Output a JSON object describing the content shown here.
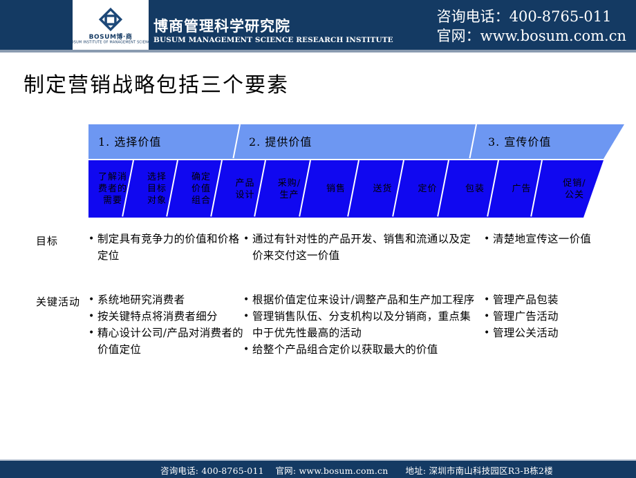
{
  "header": {
    "brand_cn": "博商管理科学研究院",
    "brand_en": "BUSUM MANAGEMENT SCIENCE RESEARCH INSTITUTE",
    "logo_word": "BOSUM博·商",
    "logo_sub": "BOSUM INSTITUTE OF MANAGEMENT SCIENCE",
    "phone_line": "咨询电话：400-8765-011",
    "web_line": "官网：www.bosum.com.cn"
  },
  "title": "制定营销战略包括三个要素",
  "banner": {
    "phases": [
      {
        "label": "1. 选择价值"
      },
      {
        "label": "2. 提供价值"
      },
      {
        "label": "3. 宣传价值"
      }
    ],
    "segments": [
      "了解消\n费者的\n需要",
      "选择\n目标\n对象",
      "确定\n价值\n组合",
      "产品\n设计",
      "采购/\n生产",
      "销售",
      "送货",
      "定价",
      "包装",
      "广告",
      "促销/\n公关"
    ],
    "colors": {
      "top_band": "#6d97f2",
      "bottom_band": "#1008f0",
      "divider": "#ffffff"
    }
  },
  "rows": [
    {
      "label": "目标",
      "columns": [
        {
          "items": [
            "制定具有竞争力的价值和价格定位"
          ]
        },
        {
          "items": [
            "通过有针对性的产品开发、销售和流通以及定价来交付这一价值"
          ]
        },
        {
          "items": [
            "清楚地宣传这一价值"
          ]
        }
      ]
    },
    {
      "label": "关键活动",
      "columns": [
        {
          "items": [
            "系统地研究消费者",
            "按关键特点将消费者细分",
            "精心设计公司/产品对消费者的价值定位"
          ]
        },
        {
          "items": [
            "根据价值定位来设计/调整产品和生产加工程序",
            "管理销售队伍、分支机构以及分销商，重点集中于优先性最高的活动",
            "给整个产品组合定价以获取最大的价值"
          ]
        },
        {
          "items": [
            "管理产品包装",
            "管理广告活动",
            "管理公关活动"
          ]
        }
      ]
    }
  ],
  "footer": {
    "text": "咨询电话: 400-8765-011    官网: www.bosum.com.cn      地址: 深圳市南山科技园区R3-B栋2楼"
  }
}
